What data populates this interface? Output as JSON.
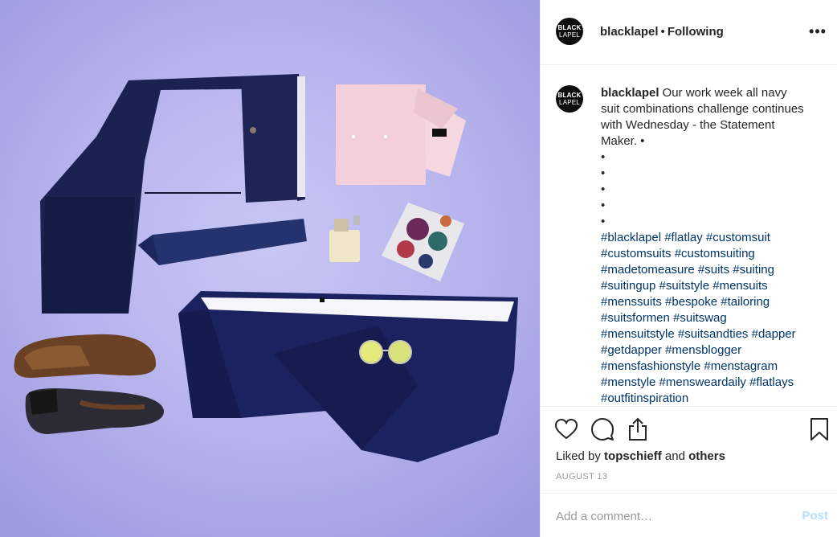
{
  "post": {
    "photo_name": "flatlay-photo",
    "username": "blacklapel",
    "separator": "•",
    "follow_status": "Following",
    "more_label": "•••",
    "avatar_text_1": "BLACK",
    "avatar_text_2": "LAPEL"
  },
  "caption": {
    "username": "blacklapel",
    "text": "Our work week all navy suit combinations challenge continues with Wednesday - the Statement Maker. •",
    "bullets": [
      "•",
      "•",
      "•",
      "•",
      "•"
    ],
    "hashtag_lines": [
      "#blacklapel #flatlay #customsuit",
      "#customsuits #customsuiting",
      "#madetomeasure #suits #suiting",
      "#suitingup #suitstyle #mensuits",
      "#menssuits #bespoke #tailoring",
      "#suitsformen #suitswag",
      "#mensuitstyle #suitsandties #dapper",
      "#getdapper #mensblogger",
      "#mensfashionstyle #menstagram",
      "#menstyle #mensweardaily #flatlays",
      "#outfitinspiration"
    ]
  },
  "actions": {
    "like_icon": "heart-icon",
    "comment_icon": "speech-bubble-icon",
    "share_icon": "share-icon",
    "save_icon": "bookmark-icon",
    "liked_prefix": "Liked by",
    "liked_user": "topschieff",
    "liked_and": "and",
    "liked_others": "others",
    "date": "August 13"
  },
  "comment_box": {
    "placeholder": "Add a comment…",
    "post_label": "Post"
  },
  "colors": {
    "background_photo": "#b9b6ee",
    "navy": "#1a1f4d",
    "link": "#003569",
    "muted": "#999999",
    "post_disabled": "#b2dffc"
  }
}
